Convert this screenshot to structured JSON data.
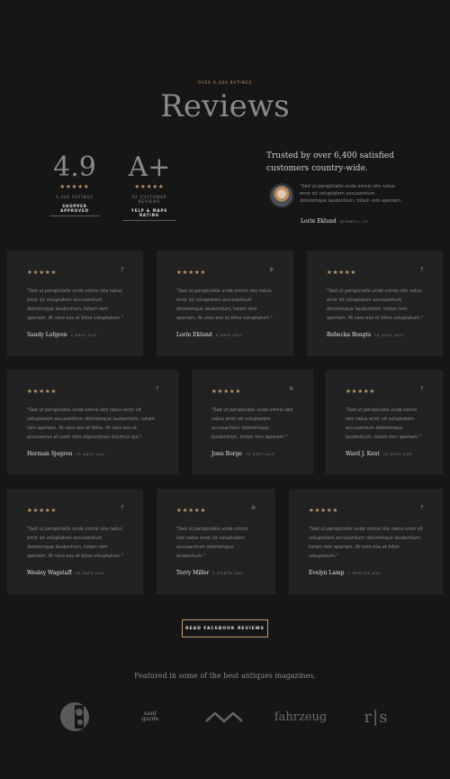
{
  "header": {
    "kicker": "OVER 6,400 RATINGS",
    "title": "Reviews"
  },
  "ratings": [
    {
      "score": "4.9",
      "stars": "★★★★★",
      "caption": "6,400 RATINGS",
      "badge": "SHOPPER APPROVED"
    },
    {
      "score": "A+",
      "stars": "★★★★★",
      "caption": "93 CUSTOMER REVIEWS",
      "badge": "YELP & MAPS RATING"
    }
  ],
  "featured_testimonial": {
    "headline": "Trusted by over 6,400 satisfied customers country-wide.",
    "quote": "\"Sed ut perspiciatis unde omnis iste natus error sit voluptatem accusantium doloremque laudantium, totam rem aperiam.",
    "author": "Lorin Eklund",
    "source": "NEWMELL.CO"
  },
  "reviews": [
    {
      "stars": "★★★★★",
      "icon": "f",
      "icon_name": "facebook-icon",
      "quote": "\"Sed ut perspiciatis unde omnis iste natus error sit voluptatem accusantium doloremque laudantium, totam rem aperiam. At vero eos et bitse voluptatum.\"",
      "name": "Sandy Lofgren",
      "date": "2 DAYS AGO"
    },
    {
      "stars": "★★★★★",
      "icon": "✲",
      "icon_name": "yelp-icon",
      "quote": "\"Sed ut perspiciatis unde omnis iste natus error sit voluptatem accusantium doloremque laudantium, totam rem aperiam. At vero eos et bitse voluptatum.\"",
      "name": "Lorin Eklund",
      "date": "6 DAYS AGO"
    },
    {
      "stars": "★★★★★",
      "icon": "f",
      "icon_name": "facebook-icon",
      "quote": "\"Sed ut perspiciatis unde omnis iste natus error sit voluptatem accusantium doloremque laudantium, totam rem aperiam. At vero eos et bitse voluptatum.\"",
      "name": "Rebecka Bengts",
      "date": "10 DAYS AGO"
    },
    {
      "stars": "★★★★★",
      "icon": "f",
      "icon_name": "facebook-icon",
      "quote": "\"Sed ut perspiciatis unde omnis iste natus error sit voluptatem accusantium doloremque laudantium, totam rem aperiam. At vero eos et bitse. At vero eos et accusamus et iusto odio dignissimos ducimus qui.\"",
      "name": "Herman Sjogren",
      "date": "15 DAYS AGO"
    },
    {
      "stars": "★★★★★",
      "icon": "✲",
      "icon_name": "yelp-icon",
      "quote": "\"Sed ut perspiciatis unde omnis iste natus error sit voluptatem accusantium doloremque laudantium, totam rem aperiam.\"",
      "name": "Jonn Borge",
      "date": "19 DAYS AGO"
    },
    {
      "stars": "★★★★★",
      "icon": "f",
      "icon_name": "facebook-icon",
      "quote": "\"Sed ut perspiciatis unde omnis iste natus error sit voluptatem accusantium doloremque laudantium, totam rem aperiam.\"",
      "name": "Ward J. Kent",
      "date": "26 DAYS AGO"
    },
    {
      "stars": "★★★★★",
      "icon": "f",
      "icon_name": "facebook-icon",
      "quote": "\"Sed ut perspiciatis unde omnis iste natus error sit voluptatem accusantium doloremque laudantium, totam rem aperiam. At vero eos et bitse voluptatum.\"",
      "name": "Wesley Wagstaff",
      "date": "26 DAYS AGO"
    },
    {
      "stars": "★★★★★",
      "icon": "✲",
      "icon_name": "yelp-icon",
      "quote": "\"Sed ut perspiciatis unde omnis iste natus error sit voluptatem accusantium doloremque laudantium.\"",
      "name": "Terry Miller",
      "date": "1 MONTH AGO"
    },
    {
      "stars": "★★★★★",
      "icon": "f",
      "icon_name": "facebook-icon",
      "quote": "\"Sed ut perspiciatis unde omnis iste natus error sit voluptatem accusantium doloremque laudantium, totam rem aperiam. At vero eos et bitse voluptatum.\"",
      "name": "Evelyn Lamp",
      "date": "2 MONTHS AGO"
    }
  ],
  "cta": {
    "label": "READ FACEBOOK REVIEWS"
  },
  "press": {
    "heading": "Featured in some of the best antiques magazines.",
    "logos": [
      {
        "name": "c-monogram-logo"
      },
      {
        "name": "sant-garde-logo",
        "text_top": "sant",
        "text_bottom": "garde"
      },
      {
        "name": "wave-logo"
      },
      {
        "name": "fahrzeug-logo",
        "text": "fahrzeug"
      },
      {
        "name": "rs-logo",
        "text": "r|s"
      }
    ]
  },
  "colors": {
    "background": "#161616",
    "card": "#222222",
    "accent": "#c39a6f",
    "text_light": "#e6e6e6",
    "text_muted": "#8a8a8a"
  }
}
